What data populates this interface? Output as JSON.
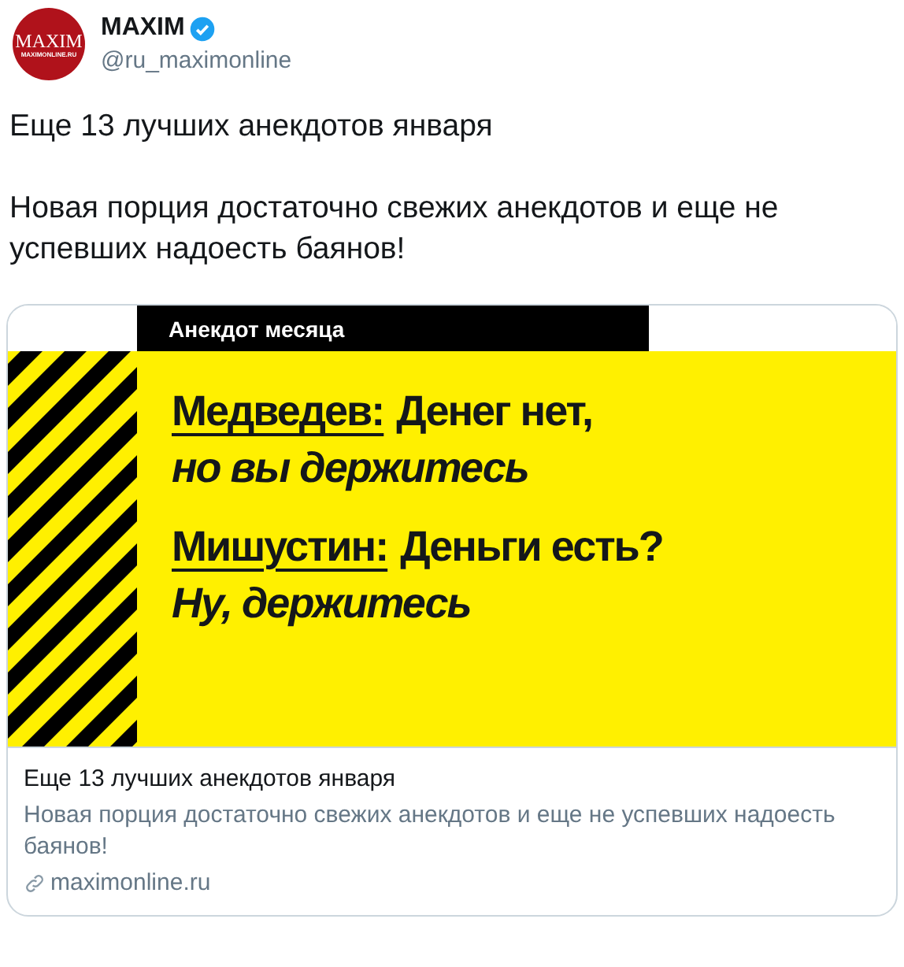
{
  "author": {
    "name": "MAXIM",
    "handle": "@ru_maximonline",
    "verified": true,
    "avatar_logo": "MAXIM",
    "avatar_sub": "MAXIMONLINE.RU"
  },
  "tweet_text": [
    "Еще 13 лучших анекдотов января",
    "Новая порция достаточно свежих анекдотов и еще не успевших надоесть баянов!"
  ],
  "card": {
    "image": {
      "label": "Анекдот месяца",
      "quotes": [
        {
          "speaker": "Медведев:",
          "line1": "Денег нет,",
          "line2": "но вы держитесь"
        },
        {
          "speaker": "Мишустин:",
          "line1": "Деньги есть?",
          "line2": "Ну, держитесь"
        }
      ]
    },
    "title": "Еще 13 лучших анекдотов января",
    "description": "Новая порция достаточно свежих анекдотов и еще не успевших надоесть баянов!",
    "domain": "maximonline.ru"
  }
}
